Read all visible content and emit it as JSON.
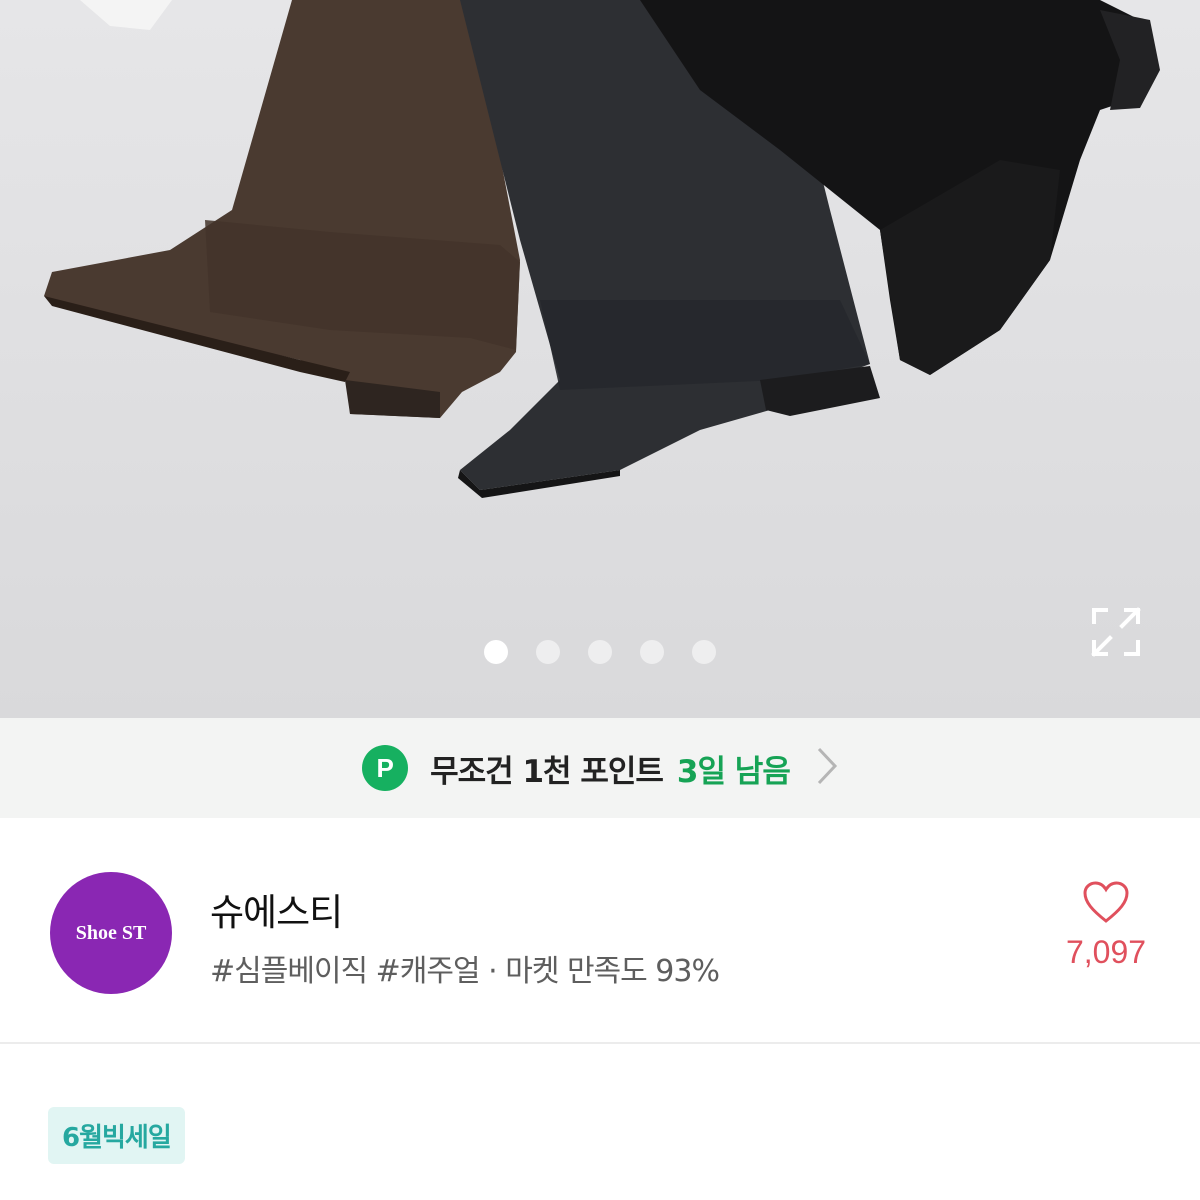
{
  "carousel": {
    "pages": 5,
    "active_index": 0,
    "expand_icon": "expand-arrows-icon"
  },
  "banner": {
    "icon_letter": "P",
    "text": "무조건 1천 포인트",
    "days_left": "3일 남음",
    "accent_color": "#16a355"
  },
  "shop": {
    "logo_text": "Shoe ST",
    "logo_color": "#8a27b3",
    "name": "슈에스티",
    "tags": "#심플베이직 #캐주얼 · 마켓 만족도 93%",
    "like_count": "7,097",
    "like_color": "#e0505d"
  },
  "sale": {
    "badge": "6월빅세일"
  }
}
